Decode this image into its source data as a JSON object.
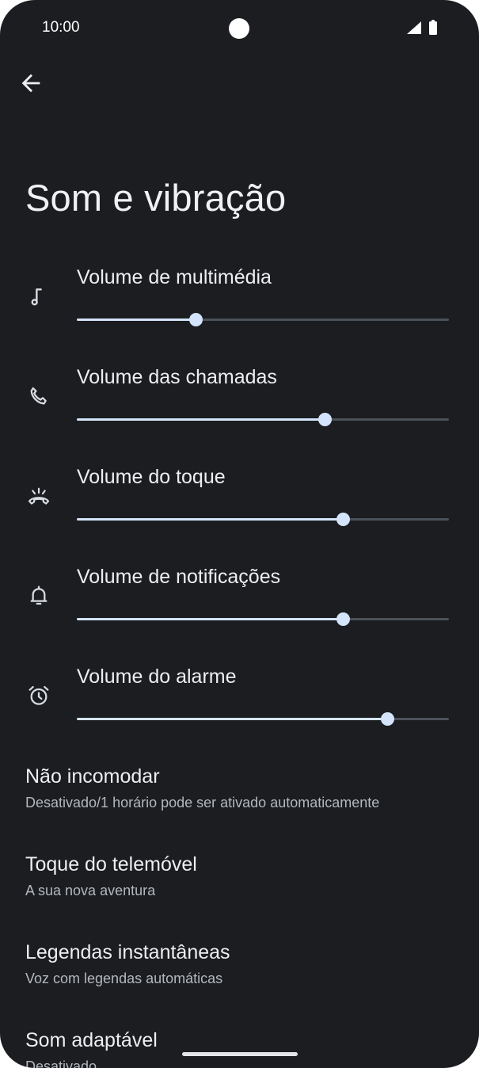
{
  "status_bar": {
    "time": "10:00"
  },
  "page": {
    "title": "Som e vibração"
  },
  "sliders": [
    {
      "label": "Volume de multimédia",
      "icon": "music-note-icon",
      "level": 0.32
    },
    {
      "label": "Volume das chamadas",
      "icon": "phone-icon",
      "level": 0.665
    },
    {
      "label": "Volume do toque",
      "icon": "ringing-phone-icon",
      "level": 0.715
    },
    {
      "label": "Volume de notificações",
      "icon": "bell-icon",
      "level": 0.715
    },
    {
      "label": "Volume do alarme",
      "icon": "alarm-clock-icon",
      "level": 0.835
    }
  ],
  "preferences": [
    {
      "title": "Não incomodar",
      "subtitle": "Desativado/1 horário pode ser ativado automaticamente"
    },
    {
      "title": "Toque do telemóvel",
      "subtitle": "A sua nova aventura"
    },
    {
      "title": "Legendas instantâneas",
      "subtitle": "Voz com legendas automáticas"
    },
    {
      "title": "Som adaptável",
      "subtitle": "Desativado"
    }
  ],
  "colors": {
    "background": "#1b1d20",
    "accent": "#d3e4fb",
    "track": "#4b5158"
  }
}
